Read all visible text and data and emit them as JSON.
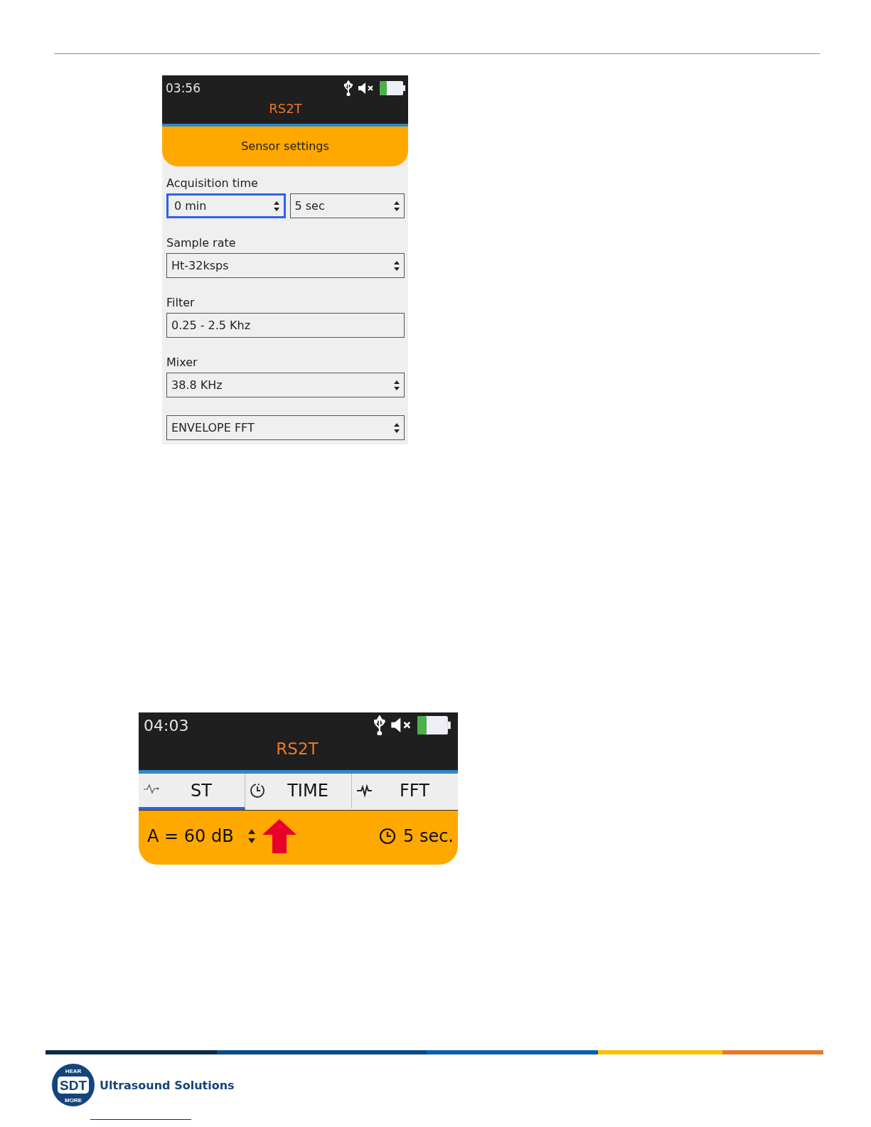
{
  "screen_1": {
    "status_time": "03:56",
    "title": "RS2T",
    "header": "Sensor settings",
    "fields": [
      {
        "label": "Acquisition time",
        "controls": [
          {
            "kind": "select",
            "value": "0 min",
            "focused": true
          },
          {
            "kind": "select",
            "value": "5 sec",
            "focused": false
          }
        ]
      },
      {
        "label": "Sample rate",
        "controls": [
          {
            "kind": "select",
            "value": "Ht-32ksps",
            "focused": false
          }
        ]
      },
      {
        "label": "Filter",
        "controls": [
          {
            "kind": "text",
            "value": "0.25 - 2.5 Khz",
            "focused": false
          }
        ]
      },
      {
        "label": "Mixer",
        "controls": [
          {
            "kind": "select",
            "value": "38.8 KHz",
            "focused": false
          }
        ]
      },
      {
        "controls": [
          {
            "kind": "select",
            "value": "ENVELOPE FFT",
            "focused": false
          }
        ]
      }
    ]
  },
  "screen_2": {
    "status_time": "04:03",
    "title": "RS2T",
    "tabs": [
      {
        "label": "ST",
        "selected": true
      },
      {
        "label": "TIME",
        "selected": false
      },
      {
        "label": "FFT",
        "selected": false
      }
    ],
    "reading": "A = 60 dB",
    "duration": "5 sec."
  },
  "footer": {
    "logo_top": "HEAR",
    "logo_mark": "SDT",
    "logo_bottom": "MORE",
    "brand": "Ultrasound Solutions"
  }
}
